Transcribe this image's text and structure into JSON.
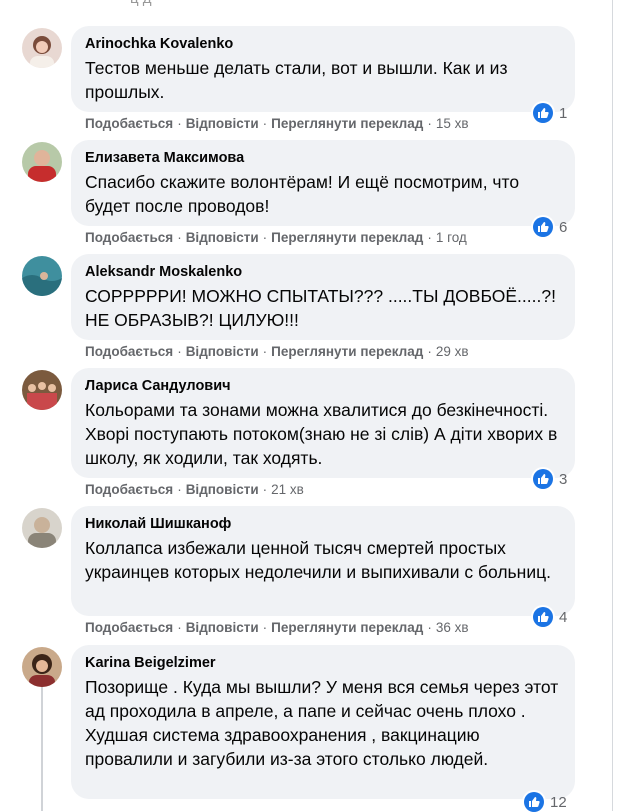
{
  "header": {
    "cut_off_text": "ц д"
  },
  "actions": {
    "like_label": "Подобається",
    "reply_label": "Відповісти",
    "translate_label": "Переглянути переклад",
    "separator": "·"
  },
  "colors": {
    "bubble_bg": "#f0f2f5",
    "meta_text": "#65676b",
    "like_blue": "#1b74e4"
  },
  "comments": [
    {
      "author": "Arinochka Kovalenko",
      "text": "Тестов меньше делать стали, вот и вышли. Как и из прошлых.",
      "time": "15 хв",
      "likes": "1",
      "avatar": "avatar-woman-icon"
    },
    {
      "author": "Елизавета Максимова",
      "text": "Спасибо скажите волонтёрам! И ещё посмотрим, что будет после проводов!",
      "time": "1 год",
      "likes": "6",
      "avatar": "avatar-red-icon"
    },
    {
      "author": "Aleksandr Moskalenko",
      "text": "СОРРРРРИ! МОЖНО СПЫТАТЫ??? .....ТЫ ДОВБОЁ.....?! НЕ ОБРАЗЫВ?! ЦИЛУЮ!!!",
      "time": "29 хв",
      "likes": "",
      "avatar": "avatar-water-icon"
    },
    {
      "author": "Лариса Сандулович",
      "text": "Кольорами та зонами можна хвалитися до безкінечності. Хворі поступають потоком(знаю не зі слів) А діти хворих в школу, як ходили, так ходять.",
      "time": "21 хв",
      "likes": "3",
      "avatar": "avatar-group-icon"
    },
    {
      "author": "Николай Шишканоф",
      "text": "Коллапса избежали ценной тысяч смертей простых украинцев которых недолечили и выпихивали с больниц.",
      "time": "36 хв",
      "likes": "4",
      "avatar": "avatar-man-icon"
    },
    {
      "author": "Karina Beigelzimer",
      "text": "Позорище . Куда мы вышли? У меня вся семья через этот ад проходила в апреле, а папе и сейчас очень плохо . Худшая система здравоохранения , вакцинацию провалили и загубили из-за этого столько людей.",
      "time": "",
      "likes": "12",
      "avatar": "avatar-woman-dark-icon"
    }
  ]
}
